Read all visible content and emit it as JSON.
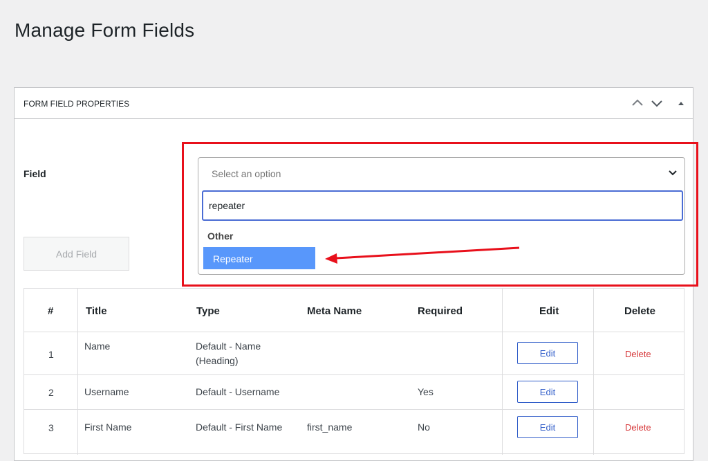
{
  "page": {
    "title": "Manage Form Fields"
  },
  "panel": {
    "title": "FORM FIELD PROPERTIES",
    "icons": [
      "chevron-up-icon",
      "chevron-down-icon",
      "triangle-up-icon"
    ]
  },
  "field": {
    "label": "Field",
    "select_placeholder": "Select an option",
    "search_value": "repeater",
    "group_label": "Other",
    "highlighted_option": "Repeater"
  },
  "add_field_label": "Add Field",
  "colors": {
    "annotation": "#e8101b",
    "highlight": "#5897fb",
    "edit_blue": "#2f5cc8",
    "delete_red": "#d63638"
  },
  "table": {
    "headers": [
      "#",
      "Title",
      "Type",
      "Meta Name",
      "Required",
      "Edit",
      "Delete"
    ],
    "rows": [
      {
        "num": "1",
        "title": "Name",
        "type": "Default - Name",
        "type_sub": "(Heading)",
        "meta": "",
        "required": "",
        "edit": "Edit",
        "delete": "Delete"
      },
      {
        "num": "2",
        "title": "Username",
        "type": "Default - Username",
        "type_sub": "",
        "meta": "",
        "required": "Yes",
        "edit": "Edit",
        "delete": ""
      },
      {
        "num": "3",
        "title": "First Name",
        "type": "Default - First Name",
        "type_sub": "",
        "meta": "first_name",
        "required": "No",
        "edit": "Edit",
        "delete": "Delete"
      }
    ]
  }
}
